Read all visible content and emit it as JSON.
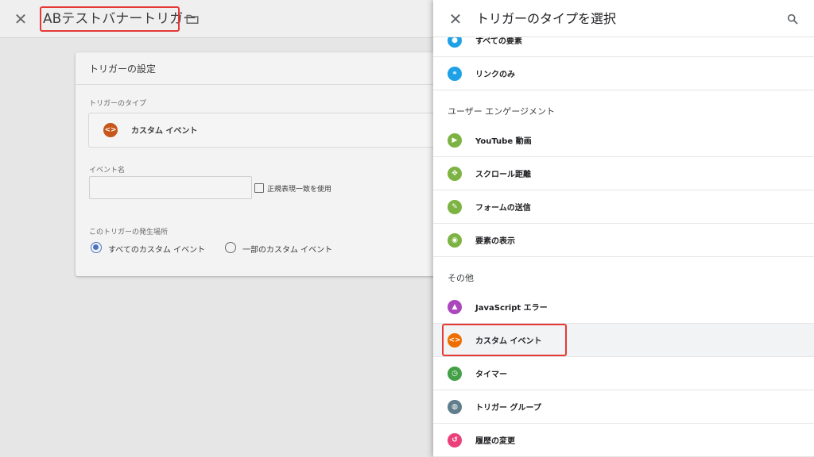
{
  "editor": {
    "close_icon": "close-icon",
    "title": "ABテストバナートリガー",
    "folder_icon": "folder-icon",
    "card": {
      "title": "トリガーの設定",
      "type_label": "トリガーのタイプ",
      "type_value": "カスタム イベント",
      "event_name_label": "イベント名",
      "event_name_value": "",
      "regex_label": "正規表現一致を使用",
      "occurrence_label": "このトリガーの発生場所",
      "options": [
        "すべてのカスタム イベント",
        "一部のカスタム イベント"
      ],
      "selected_option": "すべてのカスタム イベント"
    }
  },
  "panel": {
    "title": "トリガーのタイプを選択",
    "close_icon": "close-icon",
    "search_icon": "search-icon",
    "partial_item": "すべての要素",
    "items_top": [
      {
        "label": "リンクのみ",
        "icon": "link-icon",
        "color": "#1ea1e6"
      }
    ],
    "sections": [
      {
        "title": "ユーザー エンゲージメント",
        "items": [
          {
            "label": "YouTube 動画",
            "icon": "play-icon",
            "color": "#7cb342"
          },
          {
            "label": "スクロール距離",
            "icon": "scroll-icon",
            "color": "#7cb342"
          },
          {
            "label": "フォームの送信",
            "icon": "form-icon",
            "color": "#7cb342"
          },
          {
            "label": "要素の表示",
            "icon": "eye-icon",
            "color": "#7cb342"
          }
        ]
      },
      {
        "title": "その他",
        "items": [
          {
            "label": "JavaScript エラー",
            "icon": "warning-icon",
            "color": "#ab47bc"
          },
          {
            "label": "カスタム イベント",
            "icon": "code-icon",
            "color": "#ef6c00",
            "selected": true
          },
          {
            "label": "タイマー",
            "icon": "timer-icon",
            "color": "#43a047"
          },
          {
            "label": "トリガー グループ",
            "icon": "group-icon",
            "color": "#607d8b"
          },
          {
            "label": "履歴の変更",
            "icon": "history-icon",
            "color": "#ec407a"
          }
        ]
      }
    ]
  }
}
